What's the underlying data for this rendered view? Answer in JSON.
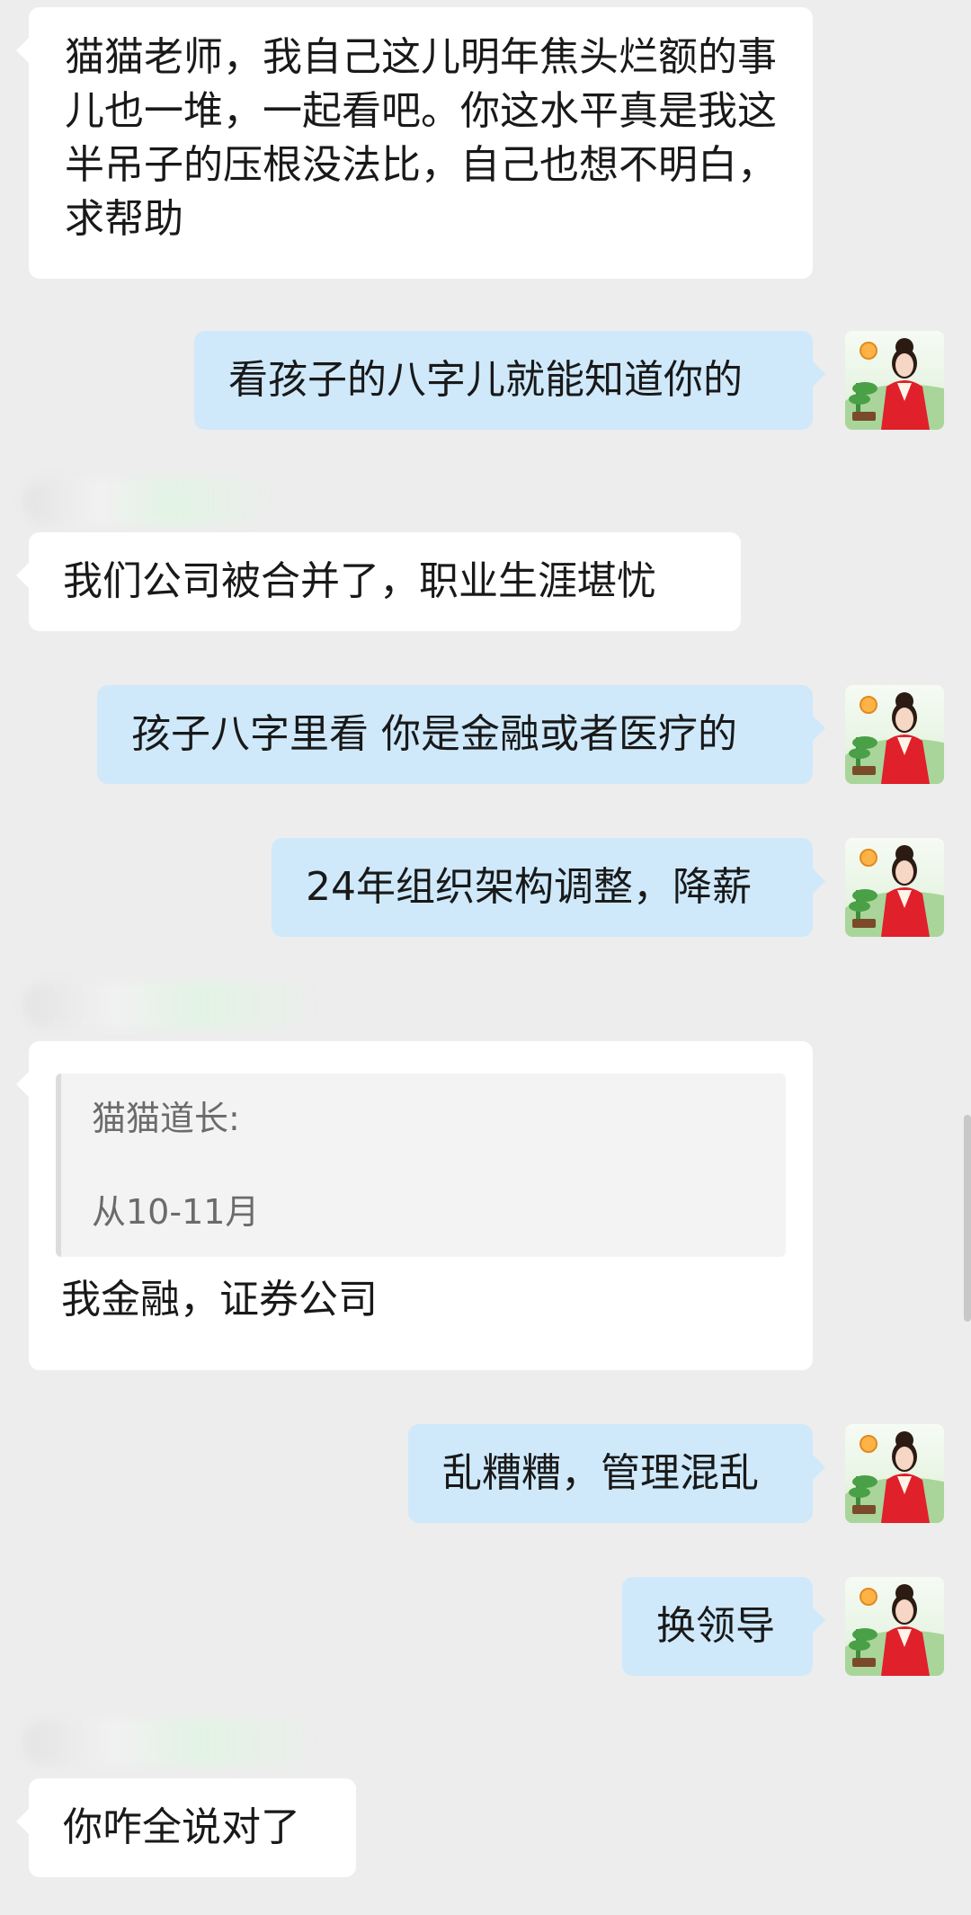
{
  "messages": {
    "m1": "猫猫老师，我自己这儿明年焦头烂额的事儿也一堆，一起看吧。你这水平真是我这半吊子的压根没法比，自己也想不明白，求帮助",
    "m2": "看孩子的八字儿就能知道你的",
    "m3": "我们公司被合并了，职业生涯堪忧",
    "m4": "孩子八字里看 你是金融或者医疗的",
    "m5": "24年组织架构调整，降薪",
    "m6": {
      "quote_author": "猫猫道长:",
      "quote_text": "从10-11月",
      "text": "我金融，证券公司"
    },
    "m7": "乱糟糟，管理混乱",
    "m8": "换领导",
    "m9": "你咋全说对了"
  },
  "colors": {
    "background": "#ededed",
    "incoming_bubble": "#ffffff",
    "outgoing_bubble": "#cfe9fb",
    "text": "#191919"
  },
  "icons": {
    "avatar": "avatar-icon"
  }
}
